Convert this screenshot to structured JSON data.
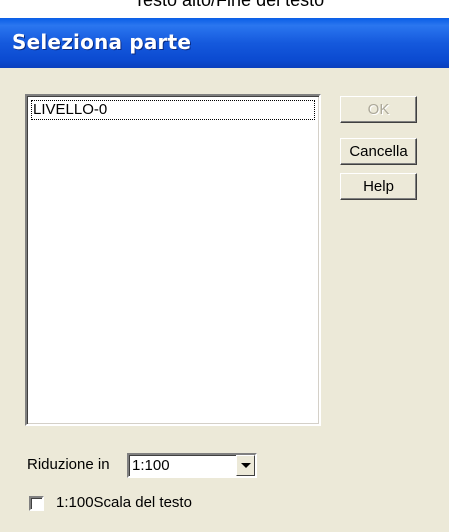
{
  "background_text": "Testo alto/Fine del testo",
  "dialog": {
    "title": "Seleziona parte"
  },
  "list": {
    "items": [
      "LIVELLO-0"
    ]
  },
  "buttons": {
    "ok": "OK",
    "cancel": "Cancella",
    "help": "Help"
  },
  "reduction": {
    "label": "Riduzione in",
    "value": "1:100"
  },
  "checkbox": {
    "label": "1:100Scala del testo",
    "checked": false
  },
  "colors": {
    "titlebar": "#0b4ad0",
    "dialog_bg": "#ece9d8",
    "disabled_text": "#aca899"
  }
}
